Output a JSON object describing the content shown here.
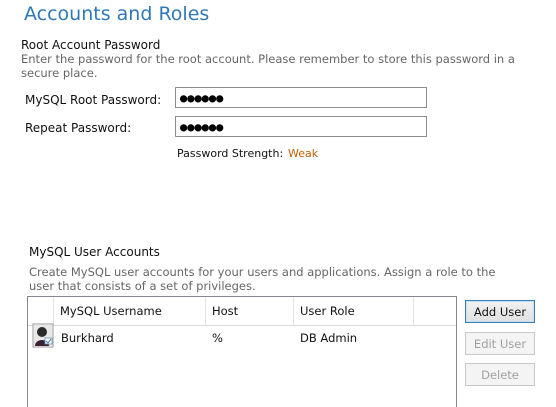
{
  "page": {
    "title": "Accounts and Roles"
  },
  "root_password": {
    "section_title": "Root Account Password",
    "description": "Enter the password for the root account.  Please remember to store this password in a secure place.",
    "password_label": "MySQL Root Password:",
    "password_value": "●●●●●●",
    "repeat_label": "Repeat Password:",
    "repeat_value": "●●●●●●",
    "strength_label": "Password Strength:",
    "strength_value": "Weak",
    "strength_color": "#c06000"
  },
  "user_accounts": {
    "section_title": "MySQL User Accounts",
    "description": "Create MySQL user accounts for your users and applications. Assign a role to the user that consists of a set of privileges.",
    "columns": {
      "username": "MySQL Username",
      "host": "Host",
      "role": "User Role"
    },
    "rows": [
      {
        "username": "Burkhard",
        "host": "%",
        "role": "DB Admin",
        "icon": "user-avatar-icon"
      }
    ],
    "buttons": {
      "add": "Add User",
      "edit": "Edit User",
      "delete": "Delete"
    }
  },
  "colors": {
    "title": "#2f79b8",
    "accent_border": "#3c7fb1",
    "disabled_text": "#a0a0a0"
  }
}
